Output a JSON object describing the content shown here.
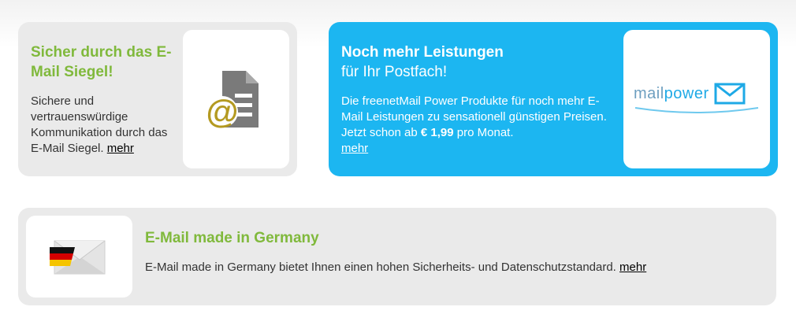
{
  "card_siegel": {
    "title": "Sicher durch das E-Mail Siegel!",
    "body": "Sichere und vertrauenswürdige Kommunikation durch das E-Mail Siegel.",
    "link": "mehr",
    "icon": "email-document-icon"
  },
  "card_power": {
    "title": "Noch mehr Leistungen",
    "subtitle": "für Ihr Postfach!",
    "body_start": "Die freenetMail Power Produkte für noch mehr E-Mail Leistungen zu sensationell günstigen Preisen. Jetzt schon ab",
    "price": "€ 1,99",
    "body_end": "pro Monat.",
    "link": "mehr",
    "logo_part1": "mail",
    "logo_part2": "power",
    "icon": "envelope-icon"
  },
  "card_germany": {
    "title": "E-Mail made in Germany",
    "body": "E-Mail made in Germany bietet Ihnen einen hohen Sicherheits- und Datenschutzstandard.",
    "link": "mehr",
    "icon": "germany-flag-envelope-icon"
  },
  "colors": {
    "green_title": "#80b93c",
    "blue_card": "#1cb6f1",
    "gray_card": "#eaeaea"
  }
}
